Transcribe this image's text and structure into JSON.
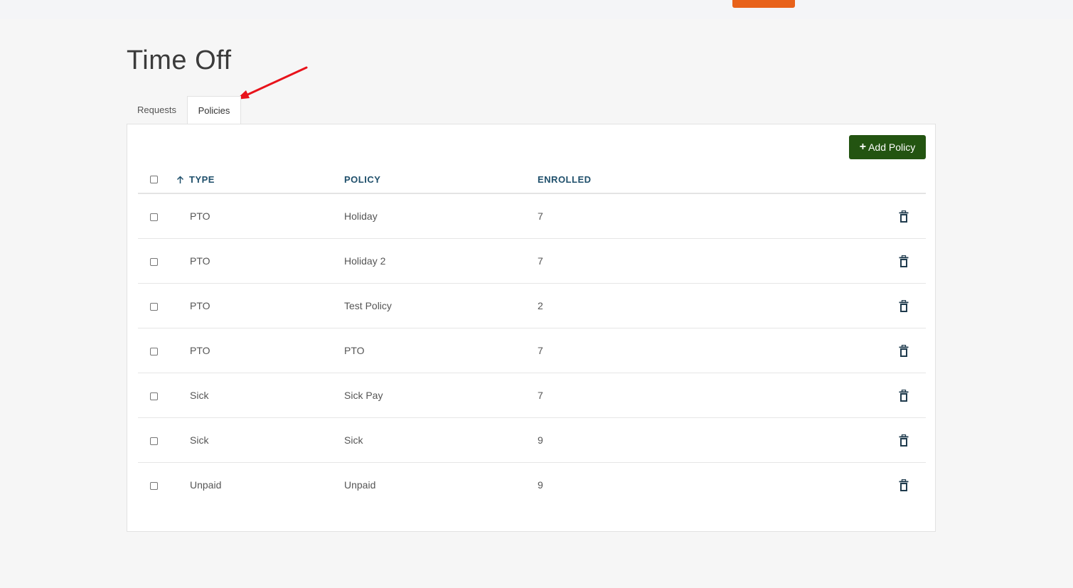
{
  "page": {
    "title": "Time Off"
  },
  "tabs": [
    {
      "label": "Requests"
    },
    {
      "label": "Policies"
    }
  ],
  "toolbar": {
    "add_label": "Add Policy"
  },
  "table": {
    "headers": {
      "type": "TYPE",
      "policy": "POLICY",
      "enrolled": "ENROLLED"
    },
    "rows": [
      {
        "type": "PTO",
        "policy": "Holiday",
        "enrolled": "7"
      },
      {
        "type": "PTO",
        "policy": "Holiday 2",
        "enrolled": "7"
      },
      {
        "type": "PTO",
        "policy": "Test Policy",
        "enrolled": "2"
      },
      {
        "type": "PTO",
        "policy": "PTO",
        "enrolled": "7"
      },
      {
        "type": "Sick",
        "policy": "Sick Pay",
        "enrolled": "7"
      },
      {
        "type": "Sick",
        "policy": "Sick",
        "enrolled": "9"
      },
      {
        "type": "Unpaid",
        "policy": "Unpaid",
        "enrolled": "9"
      }
    ]
  },
  "colors": {
    "accent_orange": "#e8621a",
    "add_button": "#235411",
    "header_text": "#1f4f6b",
    "annotation_arrow": "#e8131b"
  },
  "icons": {
    "sort": "arrow-up-icon",
    "delete": "trash-icon",
    "add": "plus-icon"
  }
}
